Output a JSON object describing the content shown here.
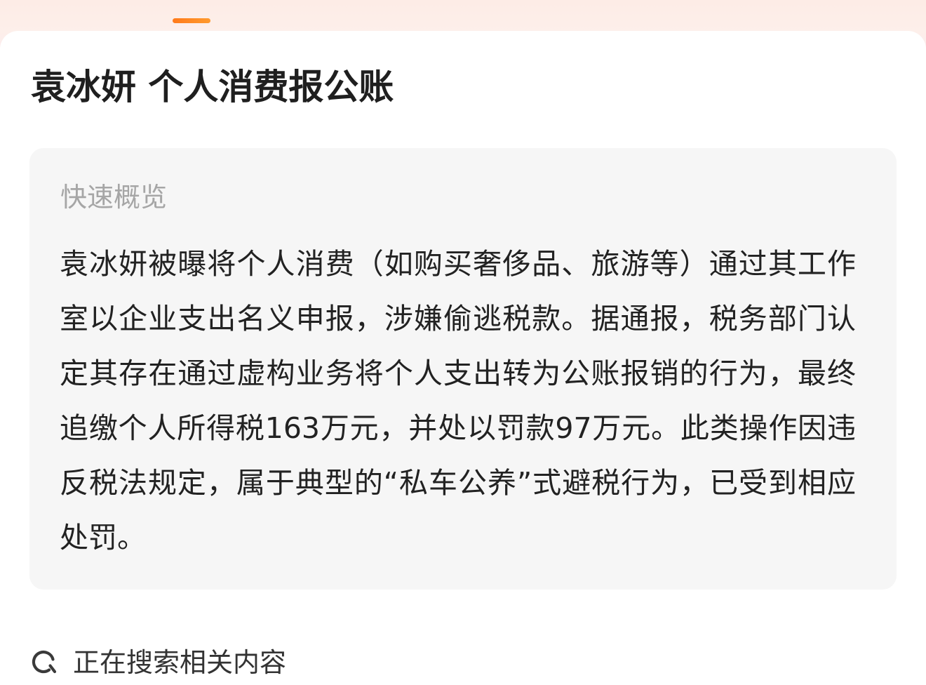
{
  "header": {
    "active_tab_indicator_color": "#ff8a1f"
  },
  "article": {
    "title": "袁冰妍 个人消费报公账"
  },
  "overview": {
    "label": "快速概览",
    "body": "袁冰妍被曝将个人消费（如购买奢侈品、旅游等）通过其工作室以企业支出名义申报，涉嫌偷逃税款。据通报，税务部门认定其存在通过虚构业务将个人支出转为公账报销的行为，最终追缴个人所得税163万元，并处以罚款97万元。此类操作因违反税法规定，属于典型的“私车公养”式避税行为，已受到相应处罚。"
  },
  "status": {
    "icon": "searching-icon",
    "text": "正在搜索相关内容"
  }
}
